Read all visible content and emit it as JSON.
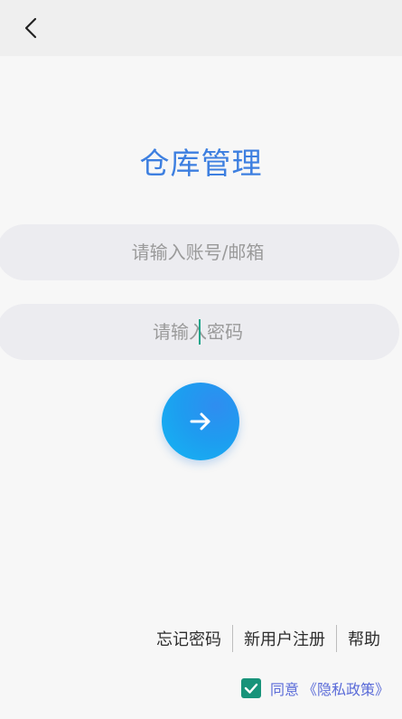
{
  "header": {
    "back_icon": "chevron-left-icon"
  },
  "title": "仓库管理",
  "login": {
    "account_placeholder": "请输入账号/邮箱",
    "password_placeholder": "请输入密码",
    "account_value": "",
    "password_value": "",
    "submit_icon": "arrow-right-icon"
  },
  "links": {
    "forgot": "忘记密码",
    "register": "新用户注册",
    "help": "帮助"
  },
  "agreement": {
    "checked": true,
    "text": "同意",
    "policy": "《隐私政策》"
  },
  "colors": {
    "title": "#3d7fe0",
    "button": "#1e9cf0",
    "checkbox": "#18937a",
    "policy": "#5a6bd8"
  }
}
